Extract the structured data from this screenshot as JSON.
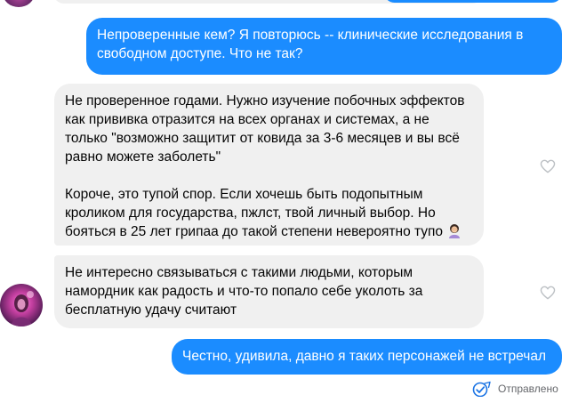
{
  "messages": [
    {
      "direction": "outgoing",
      "text": "Непроверенные кем? Я повторюсь -- клинические исследования в свободном доступе. Что не так?"
    },
    {
      "direction": "incoming",
      "text": "Не проверенное годами. Нужно изучение побочных эффектов как прививка отразится на всех органах и системах, а не только \"возможно защитит от ковида за 3-6 месяцев и вы всё равно можете заболеть\"\n\nКороче, это тупой спор. Если хочешь быть подопытным кроликом для государства, пжлст, твой личный выбор. Но бояться в 25 лет грипаа до такой степени невероятно тупо",
      "emoji": "woman-facepalming"
    },
    {
      "direction": "incoming",
      "text": "Не интересно связываться с такими людьми, которым намордник как радость и что-то попало себе уколоть за бесплатную удачу считают"
    },
    {
      "direction": "outgoing",
      "text": "Честно, удивила, давно я таких персонажей не встречал"
    }
  ],
  "status": {
    "text": "Отправлено",
    "icon": "sent-check-icon"
  },
  "colors": {
    "outgoing_bubble": "#1b8cff",
    "incoming_bubble": "#f0f0f0",
    "status_text": "#65676b"
  }
}
